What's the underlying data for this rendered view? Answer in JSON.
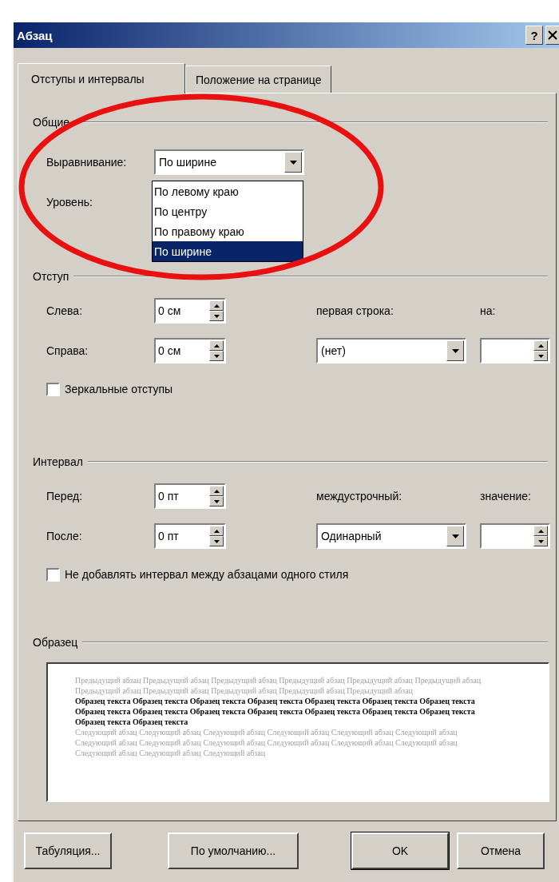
{
  "window": {
    "title": "Абзац",
    "help": "?"
  },
  "tabs": [
    {
      "label": "Отступы и интервалы",
      "selected": true
    },
    {
      "label": "Положение на странице",
      "selected": false
    }
  ],
  "general": {
    "legend": "Общие",
    "alignment": {
      "label": "Выравнивание:",
      "value": "По ширине",
      "open": true,
      "options": [
        {
          "label": "По левому краю",
          "selected": false
        },
        {
          "label": "По центру",
          "selected": false
        },
        {
          "label": "По правому краю",
          "selected": false
        },
        {
          "label": "По ширине",
          "selected": true
        }
      ]
    },
    "level": {
      "label": "Уровень:"
    }
  },
  "indent": {
    "legend": "Отступ",
    "left": {
      "label": "Слева:",
      "value": "0 см"
    },
    "right": {
      "label": "Справа:",
      "value": "0 см"
    },
    "first_line": {
      "label": "первая строка:",
      "value": "(нет)"
    },
    "by": {
      "label": "на:"
    },
    "mirror": {
      "label": "Зеркальные отступы",
      "checked": false
    }
  },
  "spacing": {
    "legend": "Интервал",
    "before": {
      "label": "Перед:",
      "value": "0 пт"
    },
    "after": {
      "label": "После:",
      "value": "0 пт"
    },
    "line": {
      "label": "междустрочный:",
      "value": "Одинарный"
    },
    "amount": {
      "label": "значение:"
    },
    "no_space": {
      "label": "Не добавлять интервал между абзацами одного стиля",
      "checked": false
    }
  },
  "preview": {
    "legend": "Образец",
    "paragraphs": [
      {
        "kind": "previous",
        "text": "Предыдущий абзац Предыдущий абзац Предыдущий абзац Предыдущий абзац Предыдущий абзац Предыдущий абзац Предыдущий абзац Предыдущий абзац Предыдущий абзац Предыдущий абзац Предыдущий абзац"
      },
      {
        "kind": "sample",
        "text": "Образец текста Образец текста Образец текста Образец текста Образец текста Образец текста Образец текста Образец текста Образец текста Образец текста Образец текста Образец текста Образец текста Образец текста Образец текста Образец текста"
      },
      {
        "kind": "next",
        "text": "Следующий абзац Следующий абзац Следующий абзац Следующий абзац Следующий абзац Следующий абзац Следующий абзац Следующий абзац Следующий абзац Следующий абзац Следующий абзац Следующий абзац Следующий абзац Следующий абзац Следующий абзац"
      }
    ]
  },
  "buttons": [
    {
      "label": "Табуляция...",
      "kind": "normal"
    },
    {
      "label": "По умолчанию...",
      "kind": "normal"
    },
    {
      "label": "OK",
      "kind": "default"
    },
    {
      "label": "Отмена",
      "kind": "normal"
    }
  ]
}
